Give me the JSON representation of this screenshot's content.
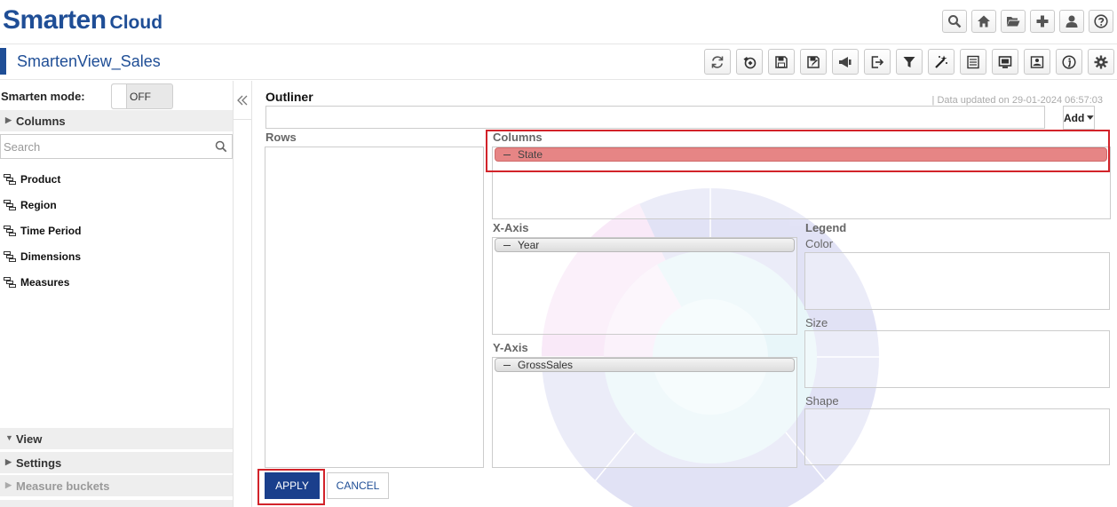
{
  "brand": {
    "name": "Smarten",
    "suffix": "Cloud"
  },
  "top_icons": [
    "search-icon",
    "home-icon",
    "folder-open-icon",
    "plus-icon",
    "user-icon",
    "help-icon"
  ],
  "view": {
    "title": "SmartenView_Sales",
    "icons": [
      "refresh-icon",
      "link-icon",
      "save-icon",
      "save-as-icon",
      "announce-icon",
      "exit-icon",
      "filter-icon",
      "magic-wand-icon",
      "list-icon",
      "screen-icon",
      "image-icon",
      "info-icon",
      "settings-icon"
    ]
  },
  "sidebar": {
    "mode_label": "Smarten mode:",
    "mode_value": "OFF",
    "columns_header": "Columns",
    "search_placeholder": "Search",
    "items": [
      {
        "label": "Product"
      },
      {
        "label": "Region"
      },
      {
        "label": "Time Period"
      },
      {
        "label": "Dimensions"
      },
      {
        "label": "Measures"
      }
    ],
    "bottom_sections": [
      {
        "label": "View",
        "expanded": true
      },
      {
        "label": "Settings",
        "expanded": false
      },
      {
        "label": "Measure buckets",
        "expanded": false
      }
    ]
  },
  "outliner": {
    "title": "Outliner",
    "data_updated": "| Data updated on  29-01-2024 06:57:03",
    "add_label": "Add",
    "rows_label": "Rows",
    "columns_label": "Columns",
    "columns_items": [
      "State"
    ],
    "xaxis_label": "X-Axis",
    "xaxis_items": [
      "Year"
    ],
    "yaxis_label": "Y-Axis",
    "yaxis_items": [
      "GrossSales"
    ],
    "legend_label": "Legend",
    "color_label": "Color",
    "size_label": "Size",
    "shape_label": "Shape"
  },
  "actions": {
    "apply": "APPLY",
    "cancel": "CANCEL"
  },
  "colors": {
    "brand": "#1f4e96",
    "apply_bg": "#1a3f8c",
    "highlight": "#d2232a",
    "pill_selected": "#e68585"
  }
}
